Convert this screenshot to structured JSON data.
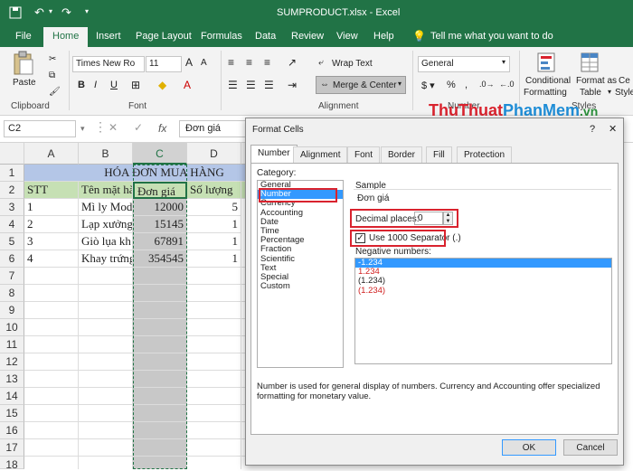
{
  "window": {
    "title": "SUMPRODUCT.xlsx - Excel"
  },
  "tabs": [
    "File",
    "Home",
    "Insert",
    "Page Layout",
    "Formulas",
    "Data",
    "Review",
    "View",
    "Help"
  ],
  "tell_me": "Tell me what you want to do",
  "ribbon": {
    "paste": "Paste",
    "clipboard": "Clipboard",
    "font_name": "Times New Ro",
    "font_size": "11",
    "font_group": "Font",
    "wrap_text": "Wrap Text",
    "merge_center": "Merge & Center",
    "alignment_group": "Alignment",
    "number_format": "General",
    "number_group": "Number",
    "conditional_formatting_1": "Conditional",
    "conditional_formatting_2": "Formatting",
    "format_as_table_1": "Format as",
    "format_as_table_2": "Table",
    "cell_styles_1": "Ce",
    "cell_styles_2": "Style",
    "styles_group": "Styles",
    "bold": "B",
    "italic": "I",
    "underline": "U"
  },
  "formula_bar": {
    "name_box": "C2",
    "content": "Đơn giá",
    "fx": "fx"
  },
  "watermark": {
    "part1": "ThuThuat",
    "part2": "PhanMem",
    "part3": ".vn"
  },
  "columns": [
    "A",
    "B",
    "C",
    "D"
  ],
  "rows": [
    "1",
    "2",
    "3",
    "4",
    "5",
    "6",
    "7",
    "8",
    "9",
    "10",
    "11",
    "12",
    "13",
    "14",
    "15",
    "16",
    "17",
    "18"
  ],
  "sheet": {
    "title": "HÓA ĐƠN MUA HÀNG",
    "headers": [
      "STT",
      "Tên mặt hà",
      "Đơn giá",
      "Số lượng"
    ],
    "data": [
      [
        "1",
        "Mì ly Mod",
        "12000",
        "5"
      ],
      [
        "2",
        "Lạp xưởng",
        "15145",
        "1"
      ],
      [
        "3",
        "Giò lụa kh",
        "67891",
        "1"
      ],
      [
        "4",
        "Khay trứng",
        "354545",
        "1"
      ]
    ]
  },
  "dialog": {
    "title": "Format Cells",
    "help": "?",
    "close": "✕",
    "tabs": [
      "Number",
      "Alignment",
      "Font",
      "Border",
      "Fill",
      "Protection"
    ],
    "category_label": "Category:",
    "categories": [
      "General",
      "Number",
      "Currency",
      "Accounting",
      "Date",
      "Time",
      "Percentage",
      "Fraction",
      "Scientific",
      "Text",
      "Special",
      "Custom"
    ],
    "selected_category": "Number",
    "sample_label": "Sample",
    "sample_value": "Đơn giá",
    "decimal_label": "Decimal places:",
    "decimal_value": "0",
    "separator_label": "Use 1000 Separator (.)",
    "separator_checked": true,
    "negative_label": "Negative numbers:",
    "negatives": [
      "-1.234",
      "1.234",
      "(1.234)",
      "(1.234)"
    ],
    "description": "Number is used for general display of numbers.  Currency and Accounting offer specialized formatting for monetary value.",
    "ok": "OK",
    "cancel": "Cancel"
  },
  "colors": {
    "excel_green": "#217346",
    "highlight": "#d9232e",
    "selected": "#3399ff",
    "header_fill": "#b4c6e7",
    "header_row_fill": "#c6e0b4"
  }
}
